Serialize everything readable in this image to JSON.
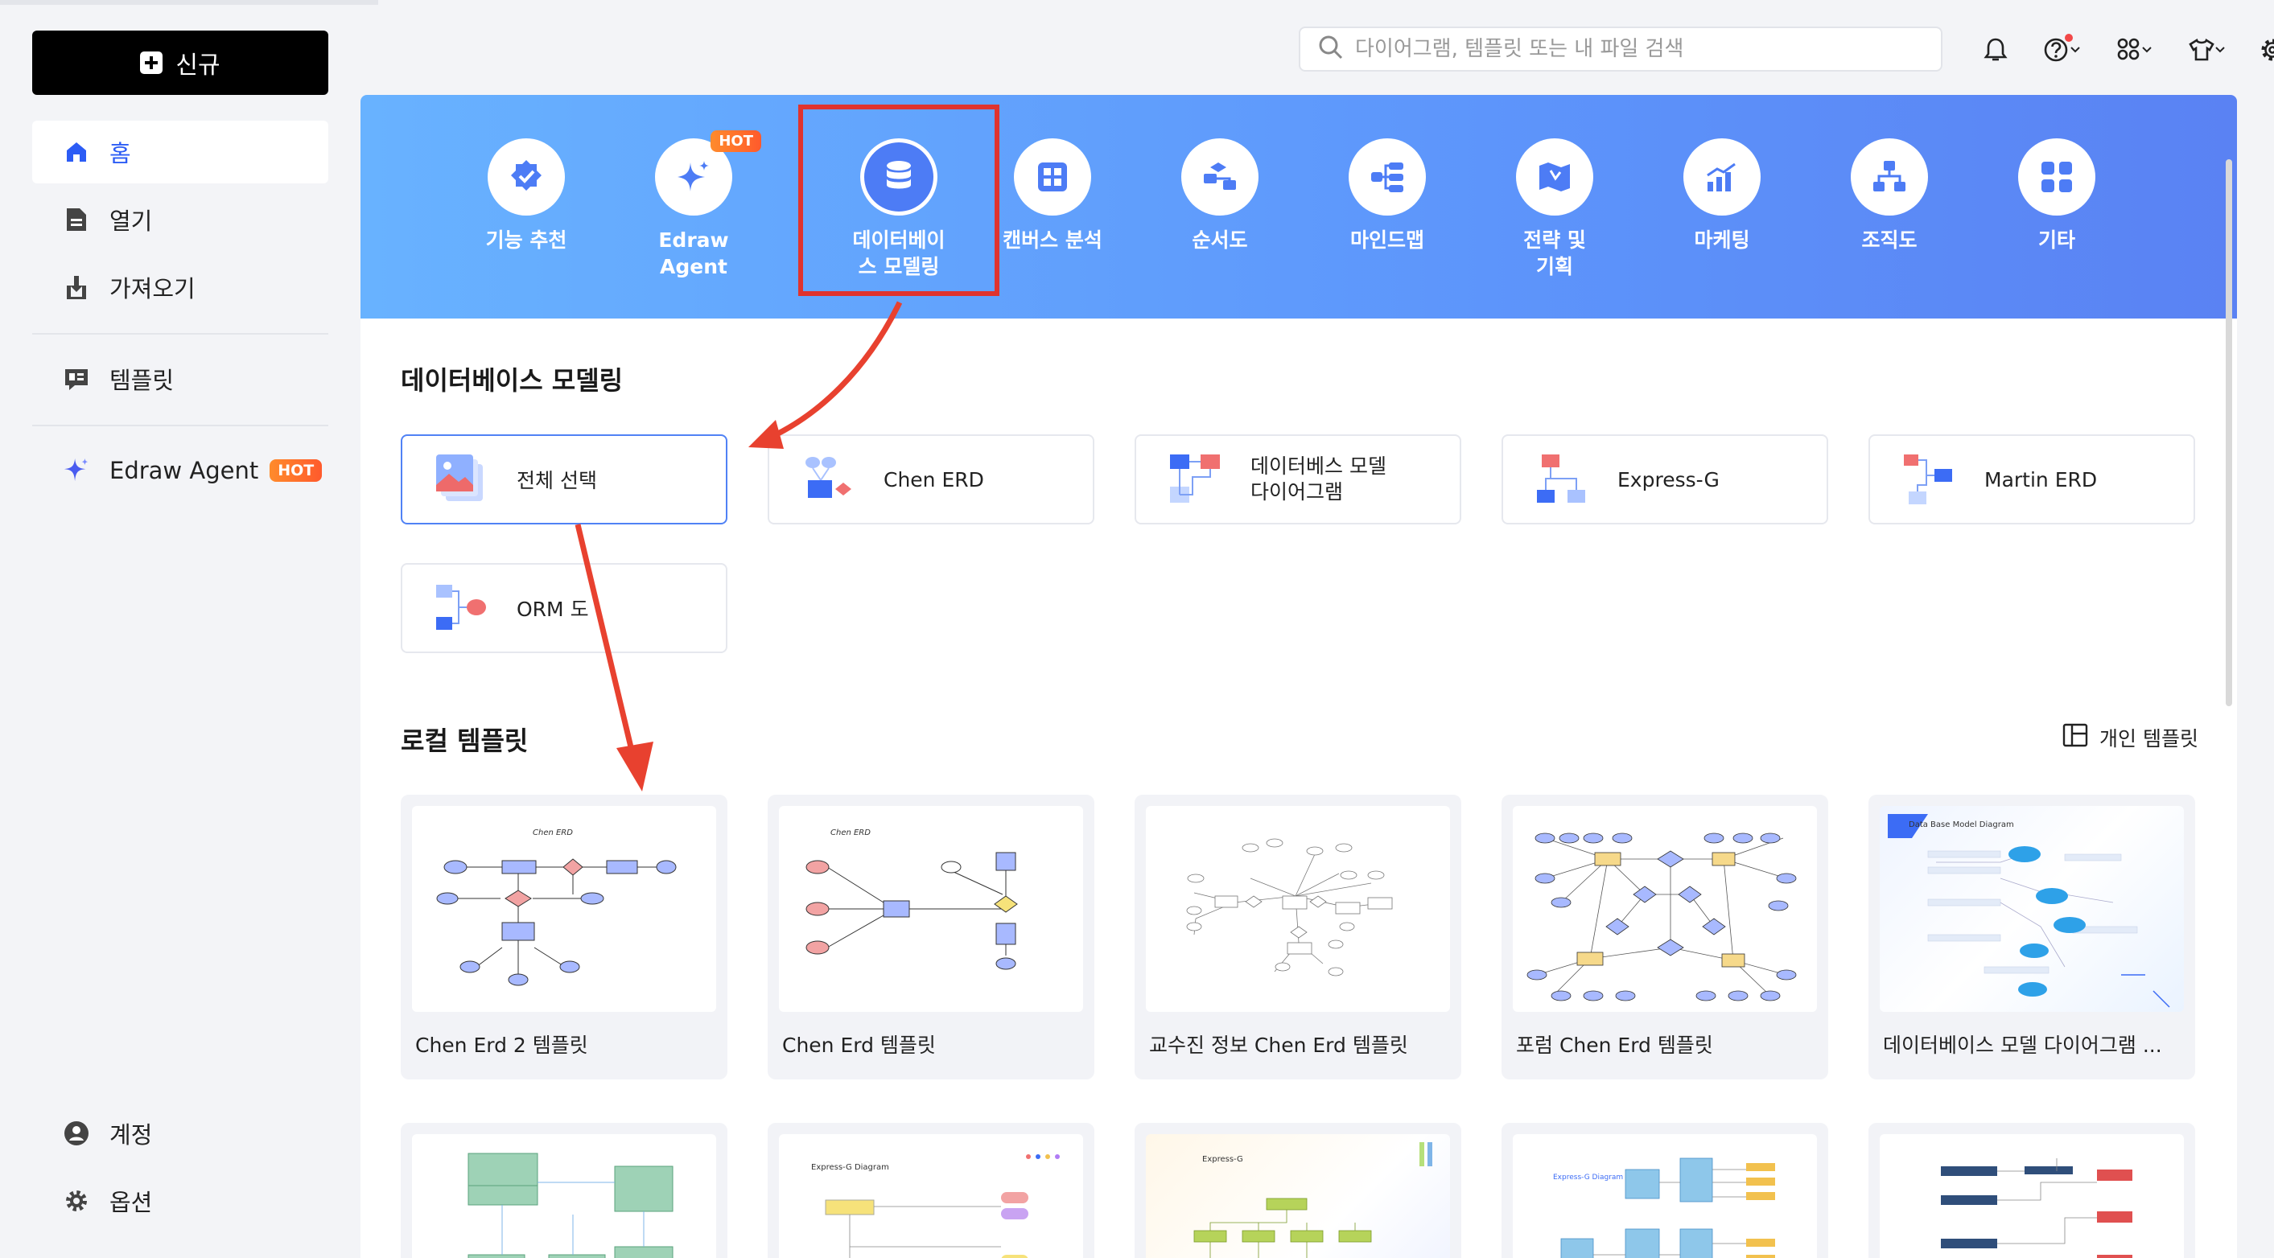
{
  "sidebar": {
    "new_label": "신규",
    "items": [
      {
        "label": "홈"
      },
      {
        "label": "열기"
      },
      {
        "label": "가져오기"
      },
      {
        "label": "템플릿"
      },
      {
        "label": "Edraw Agent",
        "badge": "HOT"
      }
    ],
    "bottom": [
      {
        "label": "계정"
      },
      {
        "label": "옵션"
      }
    ]
  },
  "search": {
    "placeholder": "다이어그램, 템플릿 또는 내 파일 검색"
  },
  "categories": [
    {
      "label": "기능 추천"
    },
    {
      "label": "Edraw\nAgent",
      "badge": "HOT"
    },
    {
      "label": "데이터베이\n스 모델링"
    },
    {
      "label": "캔버스 분석"
    },
    {
      "label": "순서도"
    },
    {
      "label": "마인드맵"
    },
    {
      "label": "전략 및\n기획"
    },
    {
      "label": "마케팅"
    },
    {
      "label": "조직도"
    },
    {
      "label": "기타"
    }
  ],
  "section1": {
    "title": "데이터베이스 모델링",
    "types": [
      {
        "label": "전체 선택"
      },
      {
        "label": "Chen ERD"
      },
      {
        "label": "데이터베스 모델\n다이어그램"
      },
      {
        "label": "Express-G"
      },
      {
        "label": "Martin ERD"
      },
      {
        "label": "ORM 도"
      }
    ]
  },
  "section2": {
    "title": "로컬 템플릿",
    "personal_label": "개인 템플릿",
    "templates": [
      {
        "caption": "Chen Erd 2 템플릿",
        "thumb_title": "Chen ERD"
      },
      {
        "caption": "Chen Erd 템플릿",
        "thumb_title": "Chen ERD"
      },
      {
        "caption": "교수진 정보 Chen Erd 템플릿"
      },
      {
        "caption": "포럼 Chen Erd 템플릿"
      },
      {
        "caption": "데이터베이스 모델 다이어그램 ...",
        "thumb_title": "Data Base Model Diagram"
      }
    ],
    "row2_thumb_titles": [
      "Express-G Diagram",
      "Express-G",
      "Express-G Diagram"
    ]
  },
  "colors": {
    "accent": "#2c5cf5",
    "highlight": "#e0332e",
    "hot": "#ff6a2c"
  }
}
